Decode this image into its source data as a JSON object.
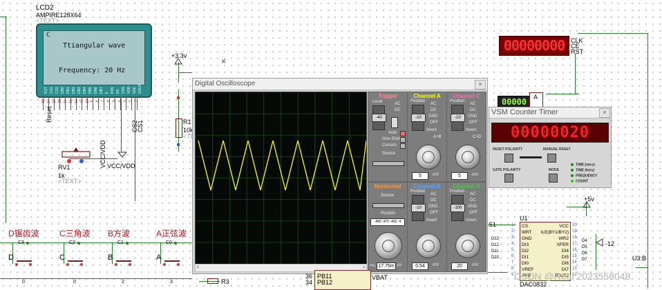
{
  "lcd": {
    "ref": "LCD2",
    "part": "AMPIRE128X64",
    "text_tag": "<TEXT>",
    "corner": "C",
    "line1": "Ttiangular wave",
    "line2": "Frequency: 20 Hz",
    "pins": [
      "RST",
      "CS1",
      "CS2",
      "DB0",
      "DB1",
      "DB2",
      "DB3",
      "DB4",
      "DB5",
      "DB6",
      "DB7",
      "E",
      "R/W",
      "D/I",
      "VSS",
      "VDD",
      "VEE",
      "VOUT"
    ]
  },
  "left_labels": {
    "reset": "Reset",
    "cs2": "CS2",
    "cs1": "CS1",
    "vccvdd": "VCC/VDD"
  },
  "rv": {
    "ref": "RV1",
    "val": "1k",
    "text": "<TEXT>"
  },
  "supply": {
    "v33": "+3.3v",
    "v5": "+5v",
    "vneg": "-12"
  },
  "r1": {
    "ref": "R1",
    "val": "10k",
    "text": "<TEXT>"
  },
  "oscilloscope": {
    "title": "Digital Oscilloscope",
    "close": "×",
    "trigger": {
      "title": "Trigger",
      "level": "Level",
      "ac": "AC",
      "dc": "DC",
      "auto": "Auto",
      "oneshot": "One-Shot",
      "cursors": "Cursors",
      "source": "Source",
      "ticks": [
        "60",
        "40",
        "20",
        "-20",
        "-40",
        "-60"
      ]
    },
    "channel_a": {
      "title": "Channel A",
      "position": "Position",
      "modes": [
        "AC",
        "DC",
        "GND",
        "OFF",
        "Invert"
      ],
      "ticks": [
        "20",
        "10",
        "-10",
        "-20"
      ],
      "readout": "5",
      "unit": "mV"
    },
    "channel_c": {
      "title": "Channel C",
      "position": "Position",
      "modes": [
        "AC",
        "DC",
        "GND",
        "OFF",
        "Invert"
      ],
      "ticks": [
        "35",
        "25",
        "10",
        "-10",
        "-25",
        "-35"
      ],
      "readout": "5",
      "unit": "mV"
    },
    "horizontal": {
      "title": "Horizontal",
      "source": "Source",
      "srcs": [
        "A",
        "B",
        "C",
        "D"
      ],
      "pos": "-480 -470 -460 -4",
      "readout": "17.75m",
      "unit": "μs",
      "ms": "ms"
    },
    "channel_b": {
      "title": "Channel B",
      "position": "Position",
      "modes": [
        "AC",
        "DC",
        "GND",
        "OFF",
        "Invert"
      ],
      "ticks": [
        "20",
        "10",
        "-10",
        "-20"
      ],
      "readout": "0.54",
      "unit": "mV"
    },
    "channel_d": {
      "title": "Channel D",
      "position": "Position",
      "modes": [
        "AC",
        "DC",
        "GND",
        "OFF",
        "Invert"
      ],
      "ticks": [
        "120",
        "60",
        "-60",
        "-120"
      ],
      "readout": "20",
      "unit": "mV"
    },
    "a_plus_b": "A+B",
    "c_plus_d": "C+D",
    "colors": {
      "a": "#ffff00",
      "b": "#4fa7ff",
      "c": "#ff69b4",
      "d": "#3fd13f",
      "trigger": "#ff8a8a",
      "horizontal": "#ff9a2e"
    }
  },
  "vsm": {
    "title": "VSM Counter Timer",
    "close": "×",
    "display": "00000020",
    "reset_polarity": "RESET POLARITY",
    "manual_reset": "MANUAL RESET",
    "gate_polarity": "GATE POLARITY",
    "mode": "MODE",
    "modes": [
      "TIME (secs)",
      "TIME (hms)",
      "FREQUENCY",
      "COUNT"
    ],
    "active_mode": "COUNT"
  },
  "red_counter": {
    "display": "00000000",
    "pins": [
      "CLK",
      "CE",
      "RST"
    ]
  },
  "small_counter": {
    "display": "00000",
    "pin": "A"
  },
  "u1": {
    "ref": "U1",
    "part": "DAC0832",
    "left_pins": [
      "CS",
      "WRT",
      "GND",
      "DI3",
      "DI2",
      "DI1",
      "DI0",
      "VREF",
      "RFB"
    ],
    "left_nums": [
      "1",
      "2",
      "3",
      "4",
      "5",
      "6",
      "7",
      "8",
      "9"
    ],
    "right_pins": [
      "VCC",
      "ILE(BY1/BY2)",
      "WR2",
      "XFER",
      "DI4",
      "DI5",
      "DI6",
      "DI7",
      "IOUT2"
    ],
    "right_nums": [
      "20",
      "19",
      "18",
      "17",
      "16",
      "15",
      "14",
      "13",
      "12"
    ],
    "d_labels": [
      "D13",
      "D12",
      "D11",
      "D10"
    ],
    "dr_labels": [
      "D4",
      "D5",
      "D6",
      "D7"
    ],
    "s1": "S1"
  },
  "buttons": [
    {
      "title": "D锯齿波",
      "net": "C3",
      "letter": "D",
      "num": "0"
    },
    {
      "title": "C三角波",
      "net": "C2",
      "letter": "C",
      "num": "0"
    },
    {
      "title": "B方波",
      "net": "C1",
      "letter": "B",
      "num": "2"
    },
    {
      "title": "A正弦波",
      "net": "C0",
      "letter": "A",
      "num": "3"
    }
  ],
  "bottom": {
    "r3": "R3",
    "pb11": "PB11",
    "pb12": "PB12",
    "p36": "36",
    "p34": "34",
    "vbat": "VBAT",
    "u3b": "U3:B",
    "watermark": "CSDN @Real 2023558048"
  }
}
